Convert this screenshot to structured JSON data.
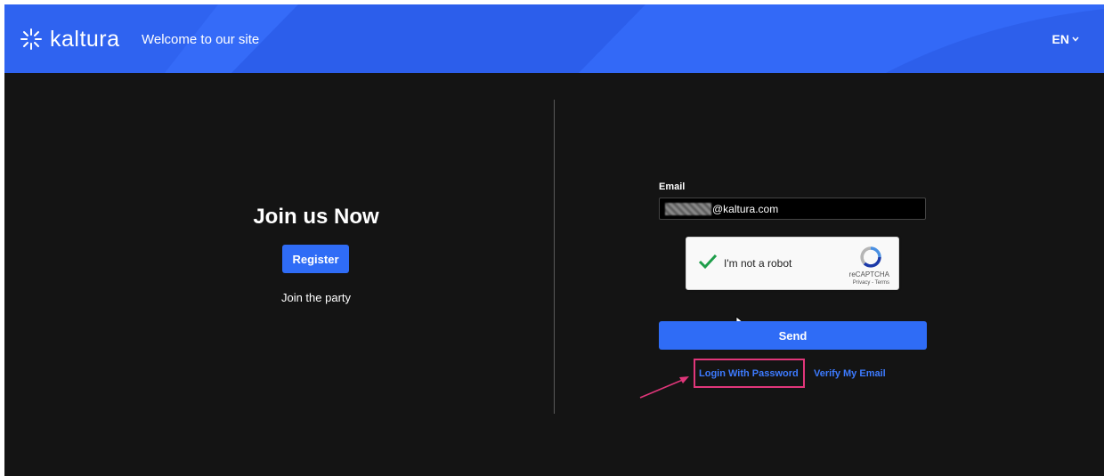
{
  "header": {
    "logo_text": "kaltura",
    "site_title": "Welcome to our site",
    "language": "EN"
  },
  "join": {
    "title": "Join us Now",
    "register_label": "Register",
    "subtitle": "Join the party"
  },
  "form": {
    "email_label": "Email",
    "email_value": "@kaltura.com",
    "captcha_label": "I'm not a robot",
    "captcha_brand": "reCAPTCHA",
    "captcha_links": "Privacy - Terms",
    "send_label": "Send",
    "login_password_label": "Login With Password",
    "verify_email_label": "Verify My Email"
  },
  "colors": {
    "header_blue": "#2f63f0",
    "button_blue": "#2f6cf6",
    "link_blue": "#3d7bff",
    "highlight_pink": "#e0367a",
    "background": "#141414"
  },
  "icons": [
    "kaltura-logo-icon",
    "chevron-down-icon",
    "checkmark-icon",
    "recaptcha-logo-icon",
    "annotation-arrow-icon",
    "mouse-cursor-icon"
  ]
}
